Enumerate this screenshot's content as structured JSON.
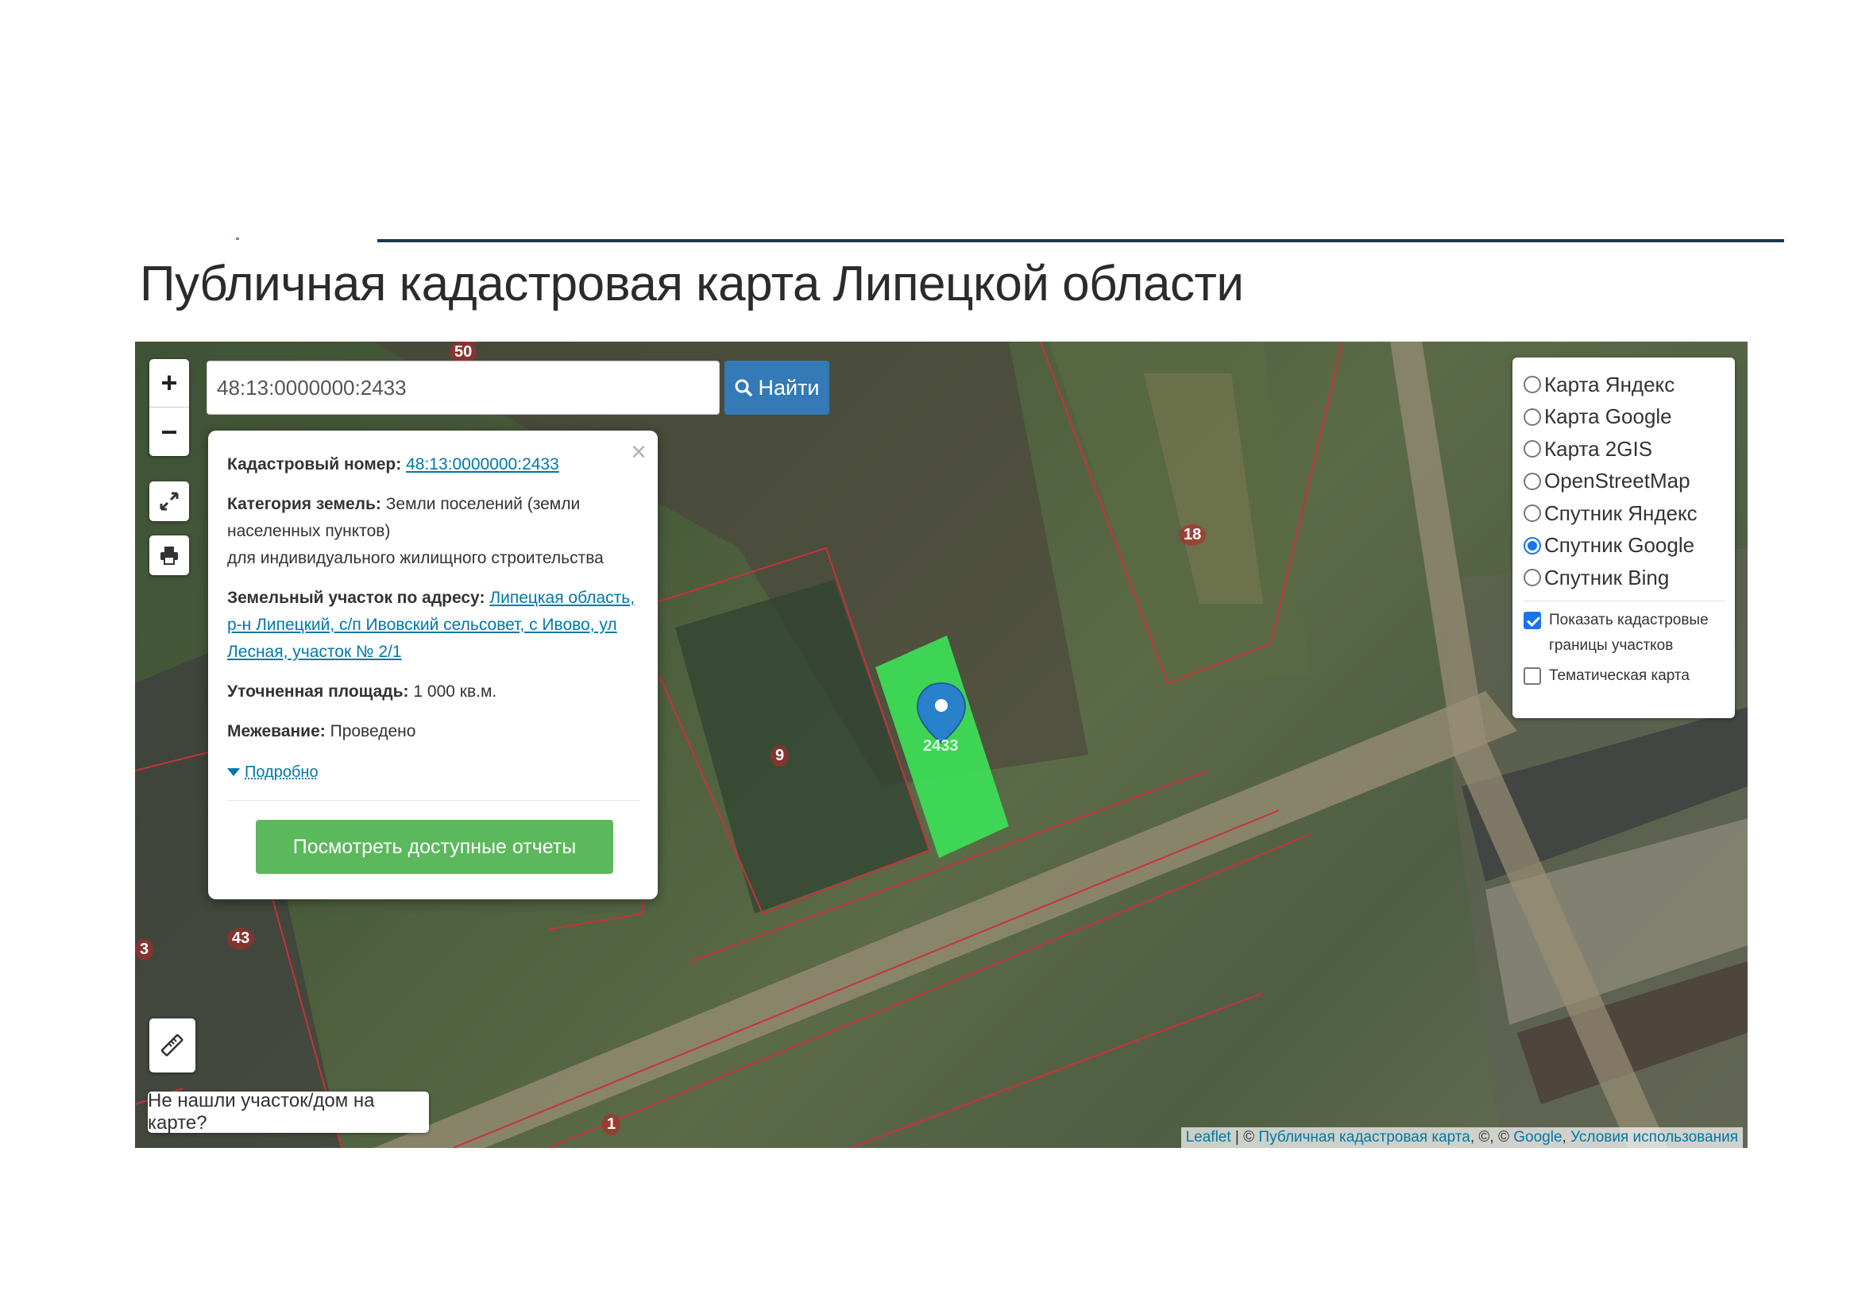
{
  "page": {
    "title": "Публичная кадастровая карта Липецкой области"
  },
  "search": {
    "value": "48:13:0000000:2433",
    "button_label": "Найти"
  },
  "zoom": {
    "in_label": "+",
    "out_label": "−"
  },
  "popup": {
    "close_label": "×",
    "cadastral_label": "Кадастровый номер:",
    "cadastral_value": "48:13:0000000:2433",
    "category_label": "Категория земель:",
    "category_value": "Земли поселений (земли населенных пунктов)",
    "usage_value": "для индивидуального жилищного строительства",
    "address_label": "Земельный участок по адресу:",
    "address_value": "Липецкая область, р-н Липецкий, с/п Ивовский сельсовет, с Ивово, ул Лесная, участок № 2/1",
    "area_label": "Уточненная площадь:",
    "area_value": "1 000 кв.м.",
    "survey_label": "Межевание:",
    "survey_value": "Проведено",
    "more_label": "Подробно",
    "reports_button": "Посмотреть доступные отчеты"
  },
  "layers": {
    "options": [
      {
        "label": "Карта Яндекс",
        "selected": false
      },
      {
        "label": "Карта Google",
        "selected": false
      },
      {
        "label": "Карта 2GIS",
        "selected": false
      },
      {
        "label": "OpenStreetMap",
        "selected": false
      },
      {
        "label": "Спутник Яндекс",
        "selected": false
      },
      {
        "label": "Спутник Google",
        "selected": true
      },
      {
        "label": "Спутник Bing",
        "selected": false
      }
    ],
    "show_borders_label": "Показать кадастровые границы участков",
    "show_borders_checked": true,
    "thematic_label": "Тематическая карта",
    "thematic_checked": false
  },
  "not_found_label": "Не нашли участок/дом на карте?",
  "attribution": {
    "leaflet": "Leaflet",
    "sep1": " | © ",
    "pkk": "Публичная кадастровая карта",
    "sep2": ", ©, © ",
    "google": "Google",
    "sep3": ", ",
    "terms": "Условия использования"
  },
  "map_labels": {
    "l50": "50",
    "l18": "18",
    "l9": "9",
    "l43": "43",
    "l3": "3",
    "l1": "1",
    "parcel": "2433"
  },
  "colors": {
    "parcel_fill": "#3ddc55",
    "border_red": "#c8323c",
    "marker_blue": "#2a81cb",
    "search_btn": "#337ab7",
    "reports_btn": "#5cb85c"
  }
}
